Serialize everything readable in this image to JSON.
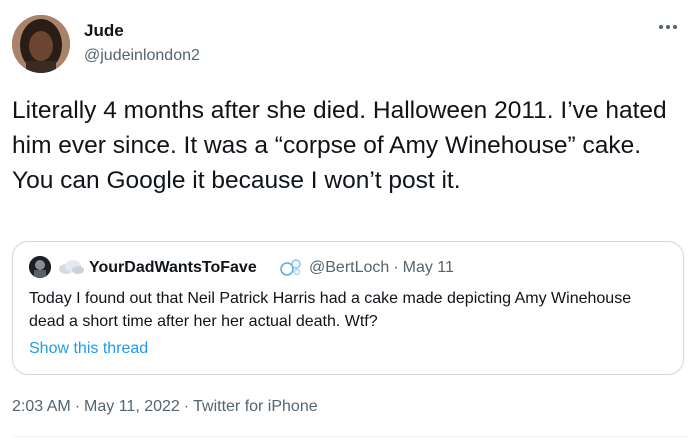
{
  "author": {
    "name": "Jude",
    "handle": "@judeinlondon2"
  },
  "more_icon": "more-horizontal-icon",
  "tweet_text": "Literally 4 months after she died. Halloween 2011. I’ve hated him ever since. It was a “corpse of Amy Winehouse” cake. You can Google it because I won’t post it.",
  "quoted_tweet": {
    "name": "YourDadWantsToFave",
    "handle": "@BertLoch",
    "date": "May 11",
    "separator": "·",
    "text": "Today I found out that Neil Patrick Harris had a cake made depicting Amy Winehouse dead a short time after her her actual death. Wtf?",
    "show_thread": "Show this thread"
  },
  "meta": {
    "time": "2:03 AM",
    "date": "May 11, 2022",
    "source": "Twitter for iPhone",
    "separator": "·"
  },
  "colors": {
    "accent": "#1d9bf0",
    "secondary_text": "#536471",
    "border": "#cfd9de"
  }
}
